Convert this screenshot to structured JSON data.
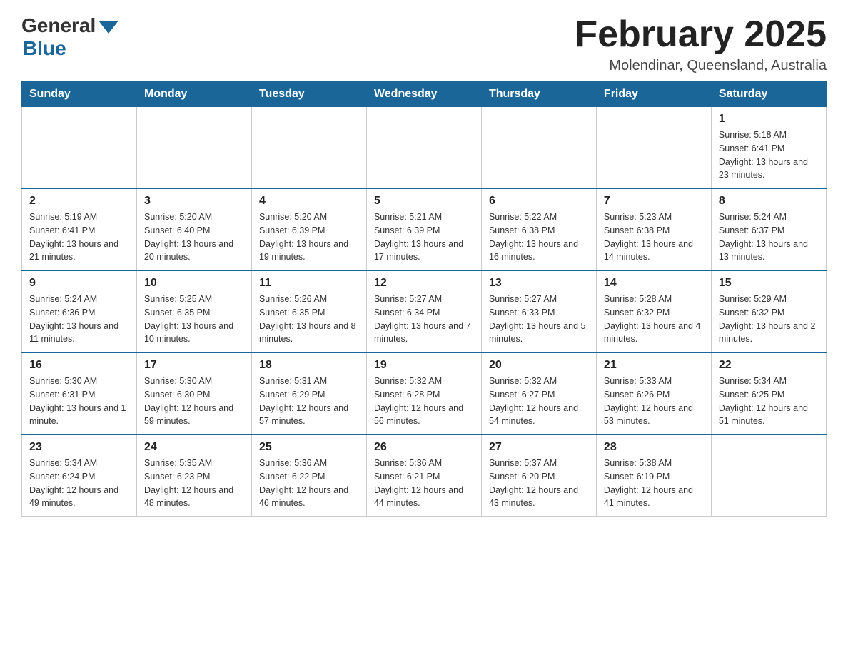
{
  "header": {
    "logo_general": "General",
    "logo_blue": "Blue",
    "month_title": "February 2025",
    "subtitle": "Molendinar, Queensland, Australia"
  },
  "weekdays": [
    "Sunday",
    "Monday",
    "Tuesday",
    "Wednesday",
    "Thursday",
    "Friday",
    "Saturday"
  ],
  "weeks": [
    {
      "days": [
        {
          "number": "",
          "info": ""
        },
        {
          "number": "",
          "info": ""
        },
        {
          "number": "",
          "info": ""
        },
        {
          "number": "",
          "info": ""
        },
        {
          "number": "",
          "info": ""
        },
        {
          "number": "",
          "info": ""
        },
        {
          "number": "1",
          "info": "Sunrise: 5:18 AM\nSunset: 6:41 PM\nDaylight: 13 hours and 23 minutes."
        }
      ]
    },
    {
      "days": [
        {
          "number": "2",
          "info": "Sunrise: 5:19 AM\nSunset: 6:41 PM\nDaylight: 13 hours and 21 minutes."
        },
        {
          "number": "3",
          "info": "Sunrise: 5:20 AM\nSunset: 6:40 PM\nDaylight: 13 hours and 20 minutes."
        },
        {
          "number": "4",
          "info": "Sunrise: 5:20 AM\nSunset: 6:39 PM\nDaylight: 13 hours and 19 minutes."
        },
        {
          "number": "5",
          "info": "Sunrise: 5:21 AM\nSunset: 6:39 PM\nDaylight: 13 hours and 17 minutes."
        },
        {
          "number": "6",
          "info": "Sunrise: 5:22 AM\nSunset: 6:38 PM\nDaylight: 13 hours and 16 minutes."
        },
        {
          "number": "7",
          "info": "Sunrise: 5:23 AM\nSunset: 6:38 PM\nDaylight: 13 hours and 14 minutes."
        },
        {
          "number": "8",
          "info": "Sunrise: 5:24 AM\nSunset: 6:37 PM\nDaylight: 13 hours and 13 minutes."
        }
      ]
    },
    {
      "days": [
        {
          "number": "9",
          "info": "Sunrise: 5:24 AM\nSunset: 6:36 PM\nDaylight: 13 hours and 11 minutes."
        },
        {
          "number": "10",
          "info": "Sunrise: 5:25 AM\nSunset: 6:35 PM\nDaylight: 13 hours and 10 minutes."
        },
        {
          "number": "11",
          "info": "Sunrise: 5:26 AM\nSunset: 6:35 PM\nDaylight: 13 hours and 8 minutes."
        },
        {
          "number": "12",
          "info": "Sunrise: 5:27 AM\nSunset: 6:34 PM\nDaylight: 13 hours and 7 minutes."
        },
        {
          "number": "13",
          "info": "Sunrise: 5:27 AM\nSunset: 6:33 PM\nDaylight: 13 hours and 5 minutes."
        },
        {
          "number": "14",
          "info": "Sunrise: 5:28 AM\nSunset: 6:32 PM\nDaylight: 13 hours and 4 minutes."
        },
        {
          "number": "15",
          "info": "Sunrise: 5:29 AM\nSunset: 6:32 PM\nDaylight: 13 hours and 2 minutes."
        }
      ]
    },
    {
      "days": [
        {
          "number": "16",
          "info": "Sunrise: 5:30 AM\nSunset: 6:31 PM\nDaylight: 13 hours and 1 minute."
        },
        {
          "number": "17",
          "info": "Sunrise: 5:30 AM\nSunset: 6:30 PM\nDaylight: 12 hours and 59 minutes."
        },
        {
          "number": "18",
          "info": "Sunrise: 5:31 AM\nSunset: 6:29 PM\nDaylight: 12 hours and 57 minutes."
        },
        {
          "number": "19",
          "info": "Sunrise: 5:32 AM\nSunset: 6:28 PM\nDaylight: 12 hours and 56 minutes."
        },
        {
          "number": "20",
          "info": "Sunrise: 5:32 AM\nSunset: 6:27 PM\nDaylight: 12 hours and 54 minutes."
        },
        {
          "number": "21",
          "info": "Sunrise: 5:33 AM\nSunset: 6:26 PM\nDaylight: 12 hours and 53 minutes."
        },
        {
          "number": "22",
          "info": "Sunrise: 5:34 AM\nSunset: 6:25 PM\nDaylight: 12 hours and 51 minutes."
        }
      ]
    },
    {
      "days": [
        {
          "number": "23",
          "info": "Sunrise: 5:34 AM\nSunset: 6:24 PM\nDaylight: 12 hours and 49 minutes."
        },
        {
          "number": "24",
          "info": "Sunrise: 5:35 AM\nSunset: 6:23 PM\nDaylight: 12 hours and 48 minutes."
        },
        {
          "number": "25",
          "info": "Sunrise: 5:36 AM\nSunset: 6:22 PM\nDaylight: 12 hours and 46 minutes."
        },
        {
          "number": "26",
          "info": "Sunrise: 5:36 AM\nSunset: 6:21 PM\nDaylight: 12 hours and 44 minutes."
        },
        {
          "number": "27",
          "info": "Sunrise: 5:37 AM\nSunset: 6:20 PM\nDaylight: 12 hours and 43 minutes."
        },
        {
          "number": "28",
          "info": "Sunrise: 5:38 AM\nSunset: 6:19 PM\nDaylight: 12 hours and 41 minutes."
        },
        {
          "number": "",
          "info": ""
        }
      ]
    }
  ]
}
